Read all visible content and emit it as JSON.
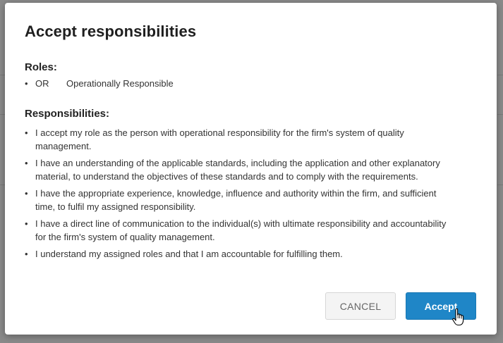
{
  "dialog": {
    "title": "Accept responsibilities",
    "roles_heading": "Roles:",
    "roles": [
      {
        "code": "OR",
        "name": "Operationally Responsible"
      }
    ],
    "responsibilities_heading": "Responsibilities:",
    "responsibilities": [
      "I accept my role as the person with operational responsibility for the firm's system of quality management.",
      "I have an understanding of the applicable standards, including the application and other explanatory material, to understand the objectives of these standards and to comply with the requirements.",
      "I have the appropriate experience, knowledge, influence and authority within the firm, and sufficient time, to fulfil my assigned responsibility.",
      "I have a direct line of communication to the individual(s) with ultimate responsibility and accountability for the firm's system of quality management.",
      "I understand my assigned roles and that I am accountable for fulfilling them."
    ],
    "cancel_label": "CANCEL",
    "accept_label": "Accept",
    "bullet": "•"
  },
  "colors": {
    "accent": "#1f86c7",
    "backdrop": "#8a8a8a"
  },
  "icons": {
    "cursor": "hand-pointer-icon"
  }
}
